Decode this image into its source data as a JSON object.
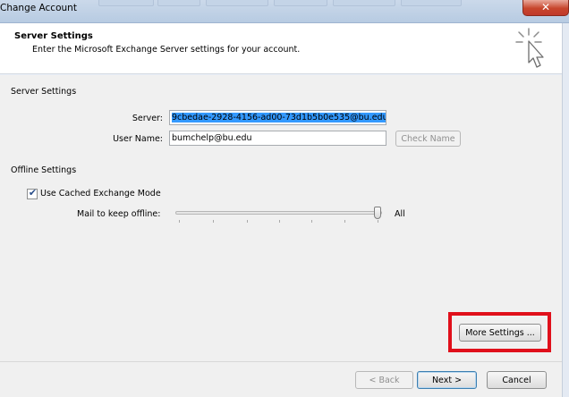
{
  "window": {
    "title": "Change Account",
    "close_glyph": "✕"
  },
  "header": {
    "title": "Server Settings",
    "subtitle": "Enter the Microsoft Exchange Server settings for your account.",
    "icon": "wand-cursor-icon"
  },
  "server_settings": {
    "section_label": "Server Settings",
    "server_label": "Server:",
    "server_value": "​9cbedae-2928-4156-ad00-73d1b5b0e535@bu.edu",
    "username_label": "User Name:",
    "username_value": "bumchelp@bu.edu",
    "check_name_label": "Check Name"
  },
  "offline_settings": {
    "section_label": "Offline Settings",
    "cached_mode_label": "Use Cached Exchange Mode",
    "cached_mode_checked": true,
    "check_glyph": "✔",
    "mail_offline_label": "Mail to keep offline:",
    "mail_offline_value_label": "All",
    "slider_level_fraction": 1.0
  },
  "buttons": {
    "more_settings": "More Settings ...",
    "back": "< Back",
    "next": "Next >",
    "cancel": "Cancel"
  },
  "colors": {
    "highlight": "#e0101b",
    "selection": "#3399ff"
  }
}
